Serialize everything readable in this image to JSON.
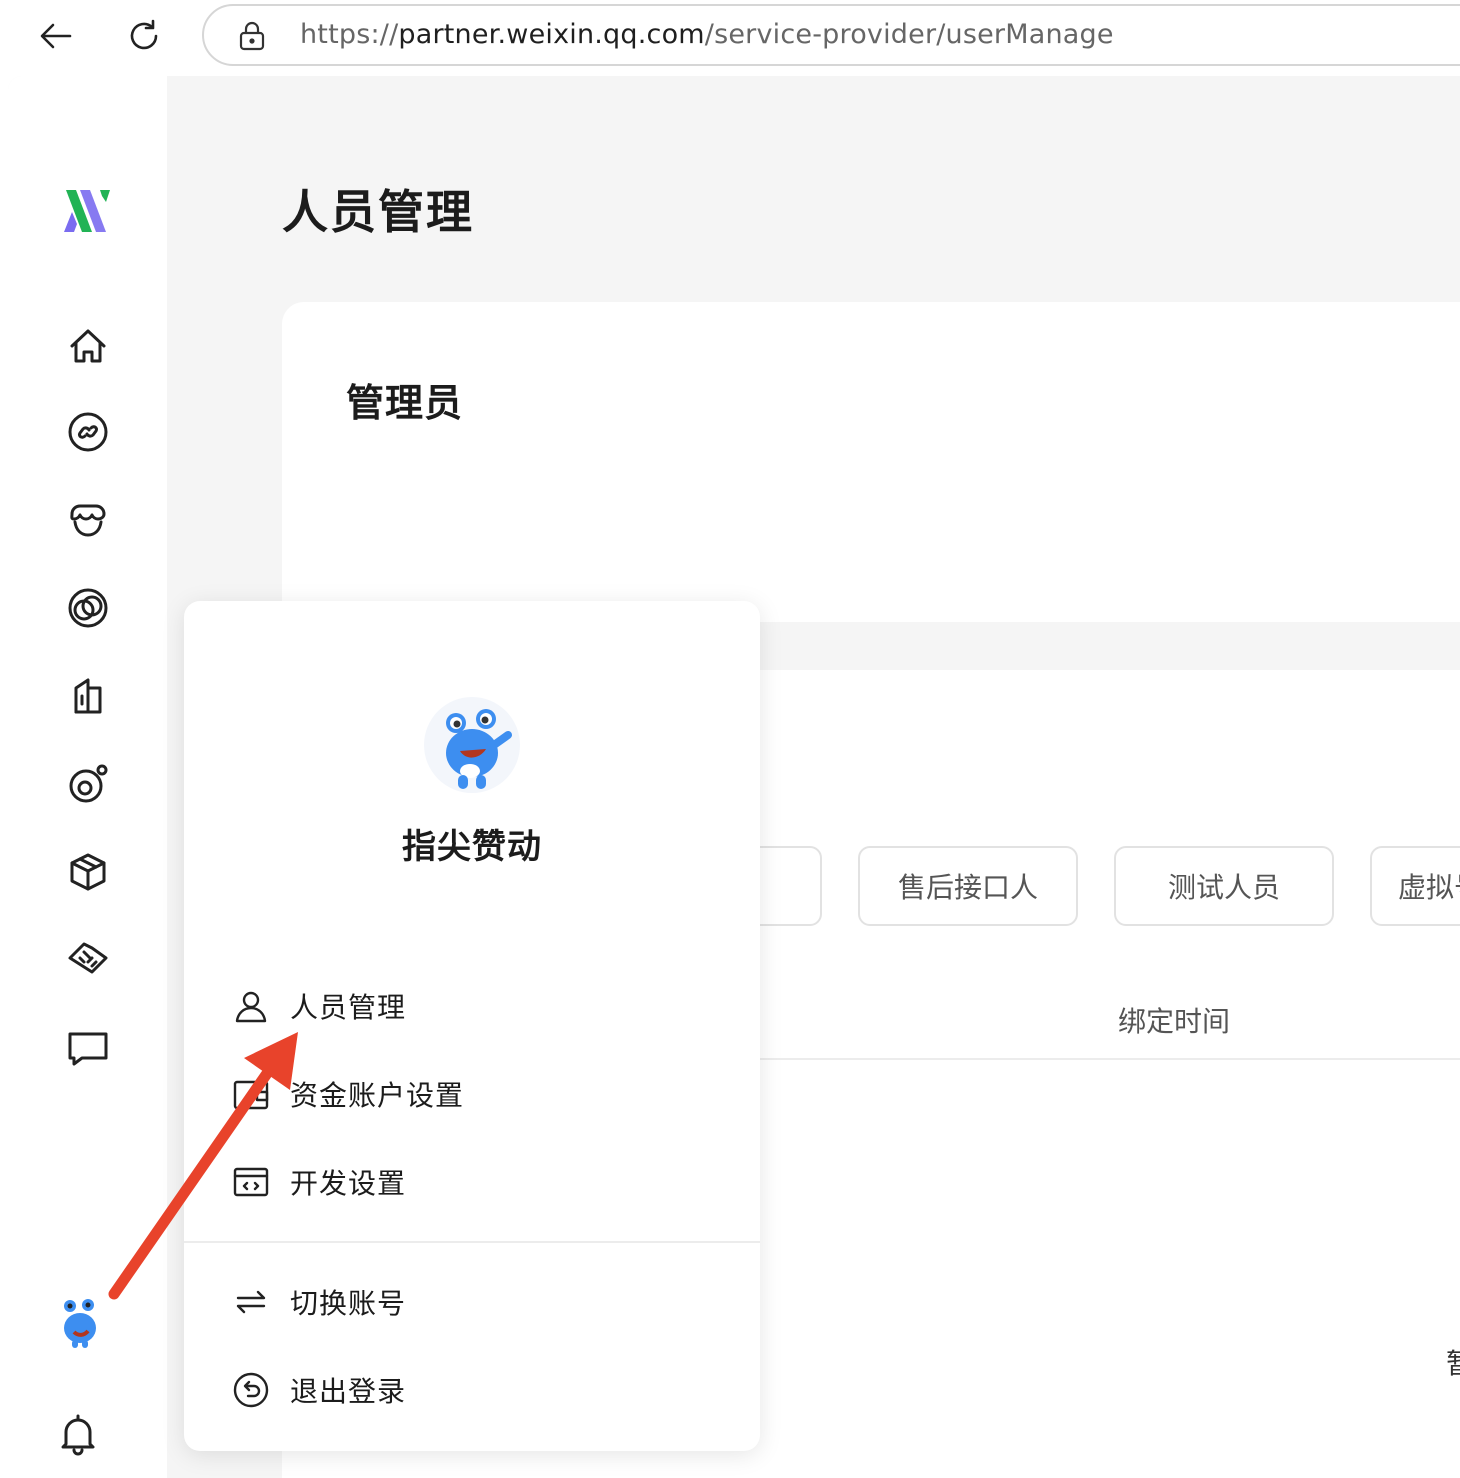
{
  "browser": {
    "url_scheme": "https://",
    "url_host": "partner.weixin.qq.com",
    "url_path": "/service-provider/userManage"
  },
  "sidebar": {
    "icons": [
      "home-icon",
      "link-icon",
      "store-icon",
      "circles-icon",
      "building-icon",
      "orbit-icon",
      "box-icon",
      "handshake-icon",
      "message-icon"
    ],
    "bottom_icons": [
      "avatar",
      "bell-icon"
    ]
  },
  "page": {
    "title": "人员管理"
  },
  "admin_card": {
    "title": "管理员"
  },
  "roles_card": {
    "tabs": [
      "售后接口人",
      "测试人员",
      "虚拟号"
    ],
    "column_header": "绑定时间",
    "empty_glyph": "暂"
  },
  "popup": {
    "account_name": "指尖赞动",
    "menu": [
      {
        "label": "人员管理",
        "icon": "user-icon"
      },
      {
        "label": "资金账户设置",
        "icon": "wallet-icon"
      },
      {
        "label": "开发设置",
        "icon": "code-window-icon"
      }
    ],
    "secondary": [
      {
        "label": "切换账号",
        "icon": "switch-icon"
      },
      {
        "label": "退出登录",
        "icon": "logout-icon"
      }
    ]
  },
  "colors": {
    "arrow": "#e8432b",
    "logo_green": "#21b355",
    "logo_purple": "#7a6cf0",
    "page_bg": "#f5f5f5"
  }
}
